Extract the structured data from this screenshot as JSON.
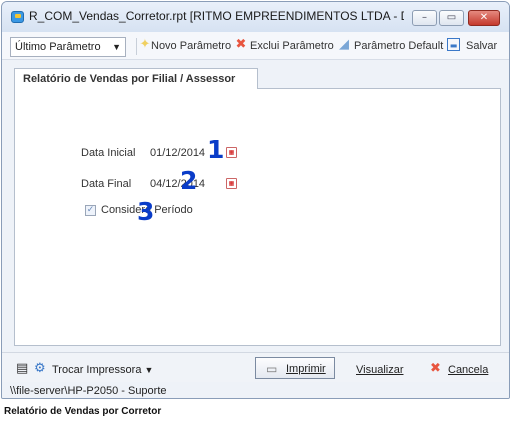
{
  "window": {
    "title": "R_COM_Vendas_Corretor.rpt [RITMO EMPREENDIMENTOS LTDA - De...",
    "minimize_label": "–",
    "maximize_label": "▭",
    "close_label": "✕"
  },
  "toolbar": {
    "parameter_select": {
      "selected": "Último Parâmetro"
    },
    "new_label": "Novo Parâmetro",
    "delete_label": "Exclui Parâmetro",
    "default_label": "Parâmetro Default",
    "save_label": "Salvar"
  },
  "tab": {
    "label": "Relatório de Vendas por Filial / Assessor"
  },
  "form": {
    "start_date_label": "Data Inicial",
    "start_date_value": "01/12/2014",
    "end_date_label": "Data Final",
    "end_date_value": "04/12/2014",
    "consider_period_label": "Considera Período",
    "consider_period_checked": true
  },
  "annotations": [
    "1",
    "2",
    "3"
  ],
  "footer": {
    "printer_label": "Trocar Impressora",
    "print_label": "Imprimir",
    "preview_label": "Visualizar",
    "cancel_label": "Cancela"
  },
  "status": {
    "printer_path": "\\\\file-server\\HP-P2050 - Suporte"
  },
  "caption": "Relatório de Vendas por Corretor",
  "colors": {
    "annotation": "#0a3cc8",
    "close_button": "#c4392c",
    "delete_icon": "#e8553f"
  }
}
